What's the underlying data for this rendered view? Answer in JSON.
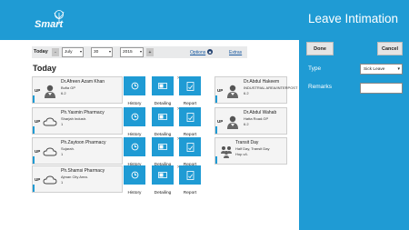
{
  "app": {
    "logo_text": "Smart"
  },
  "right_panel": {
    "title": "Leave Intimation",
    "done_label": "Done",
    "cancel_label": "Cancel",
    "type_label": "Type",
    "type_value": "Sick Leave",
    "remarks_label": "Remarks",
    "remarks_value": ""
  },
  "datebar": {
    "label": "Today",
    "prev": "-",
    "month": "July",
    "day": "30",
    "year": "2015",
    "next": "+",
    "options": "Options",
    "extras": "Extras"
  },
  "section_title": "Today",
  "tiles": {
    "history": "History",
    "detailing": "Detailing",
    "report": "Report"
  },
  "left_column": [
    {
      "badge": "UP",
      "name": "Dr.Afreen Azam Khan",
      "address": "Bufia GP",
      "number": "6.2"
    },
    {
      "badge": "UP",
      "name": "Ph.Yasmin Pharmacy",
      "address": "Sharjah Industr.",
      "number": "1"
    },
    {
      "badge": "UP",
      "name": "Ph.Zaytoon Pharmacy",
      "address": "Sujarah.",
      "number": "1"
    },
    {
      "badge": "UP",
      "name": "Ph.Shamsi Pharmacy",
      "address": "Ajman City Area.",
      "number": "1"
    }
  ],
  "right_column": [
    {
      "badge": "UP",
      "name": "Dr.Abdul Hakeem",
      "address": "INDUSTRIAL AREA/INTERPOST",
      "number": "6.2"
    },
    {
      "badge": "UP",
      "name": "Dr.Abdul Wahab",
      "address": "Hatta Road.GP",
      "number": "6.2"
    },
    {
      "badge": "",
      "name": "Transit Day",
      "address": "Half Day, Transit Day",
      "number": "Hop c/L"
    }
  ],
  "colors": {
    "accent": "#1f9bd4",
    "card_bg": "#f4f4f4",
    "toolbar_bg": "#e9eaeb"
  }
}
